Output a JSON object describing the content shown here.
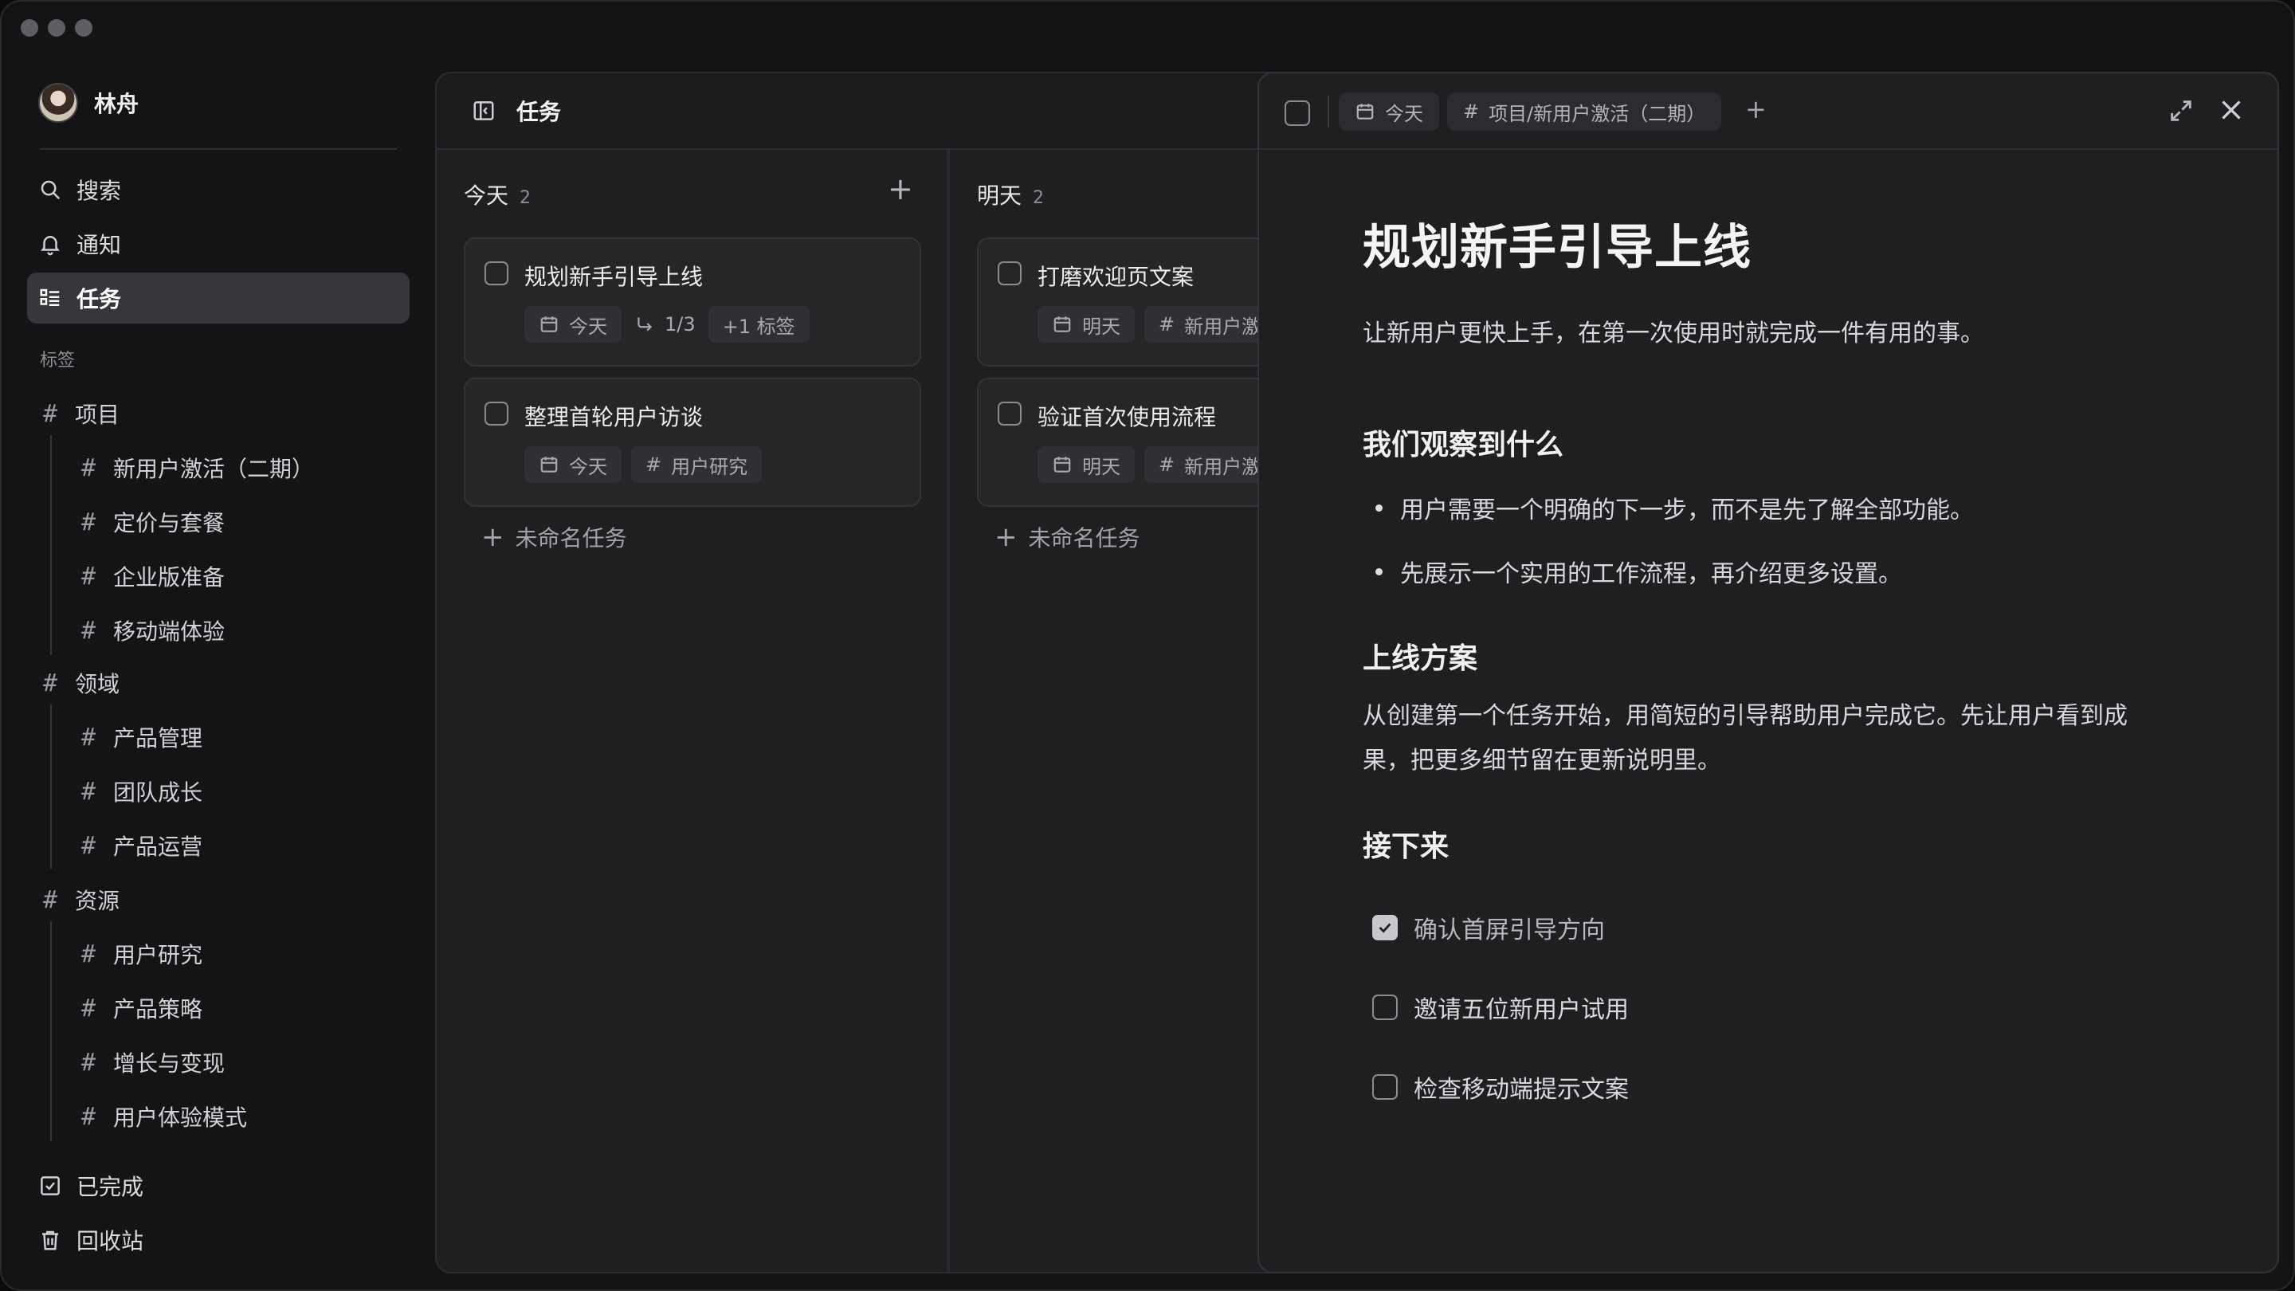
{
  "user": {
    "name": "林舟"
  },
  "nav": {
    "search": "搜索",
    "notifications": "通知",
    "tasks": "任务",
    "completed": "已完成",
    "trash": "回收站"
  },
  "tags_section": "标签",
  "tags": [
    {
      "label": "项目",
      "children": [
        "新用户激活（二期）",
        "定价与套餐",
        "企业版准备",
        "移动端体验"
      ]
    },
    {
      "label": "领域",
      "children": [
        "产品管理",
        "团队成长",
        "产品运营"
      ]
    },
    {
      "label": "资源",
      "children": [
        "用户研究",
        "产品策略",
        "增长与变现",
        "用户体验模式"
      ]
    }
  ],
  "main": {
    "title": "任务"
  },
  "columns": [
    {
      "title": "今天",
      "count": "2",
      "cards": [
        {
          "title": "规划新手引导上线",
          "date": "今天",
          "subtasks": "1/3",
          "extra_tags": "+1 标签"
        },
        {
          "title": "整理首轮用户访谈",
          "date": "今天",
          "tag": "用户研究"
        }
      ],
      "add_label": "未命名任务"
    },
    {
      "title": "明天",
      "count": "2",
      "cards": [
        {
          "title": "打磨欢迎页文案",
          "date": "明天",
          "tag": "新用户激"
        },
        {
          "title": "验证首次使用流程",
          "date": "明天",
          "tag": "新用户激"
        }
      ],
      "add_label": "未命名任务"
    }
  ],
  "detail": {
    "date_chip": "今天",
    "project_chip": "项目/新用户激活（二期）",
    "title": "规划新手引导上线",
    "intro": "让新用户更快上手，在第一次使用时就完成一件有用的事。",
    "section1": "我们观察到什么",
    "bullets": [
      "用户需要一个明确的下一步，而不是先了解全部功能。",
      "先展示一个实用的工作流程，再介绍更多设置。"
    ],
    "section2": "上线方案",
    "plan_line1": "从创建第一个任务开始，用简短的引导帮助用户完成它。先让用户看到成",
    "plan_line2": "果，把更多细节留在更新说明里。",
    "section3": "接下来",
    "todos": [
      {
        "label": "确认首屏引导方向",
        "done": true
      },
      {
        "label": "邀请五位新用户试用",
        "done": false
      },
      {
        "label": "检查移动端提示文案",
        "done": false
      }
    ]
  }
}
